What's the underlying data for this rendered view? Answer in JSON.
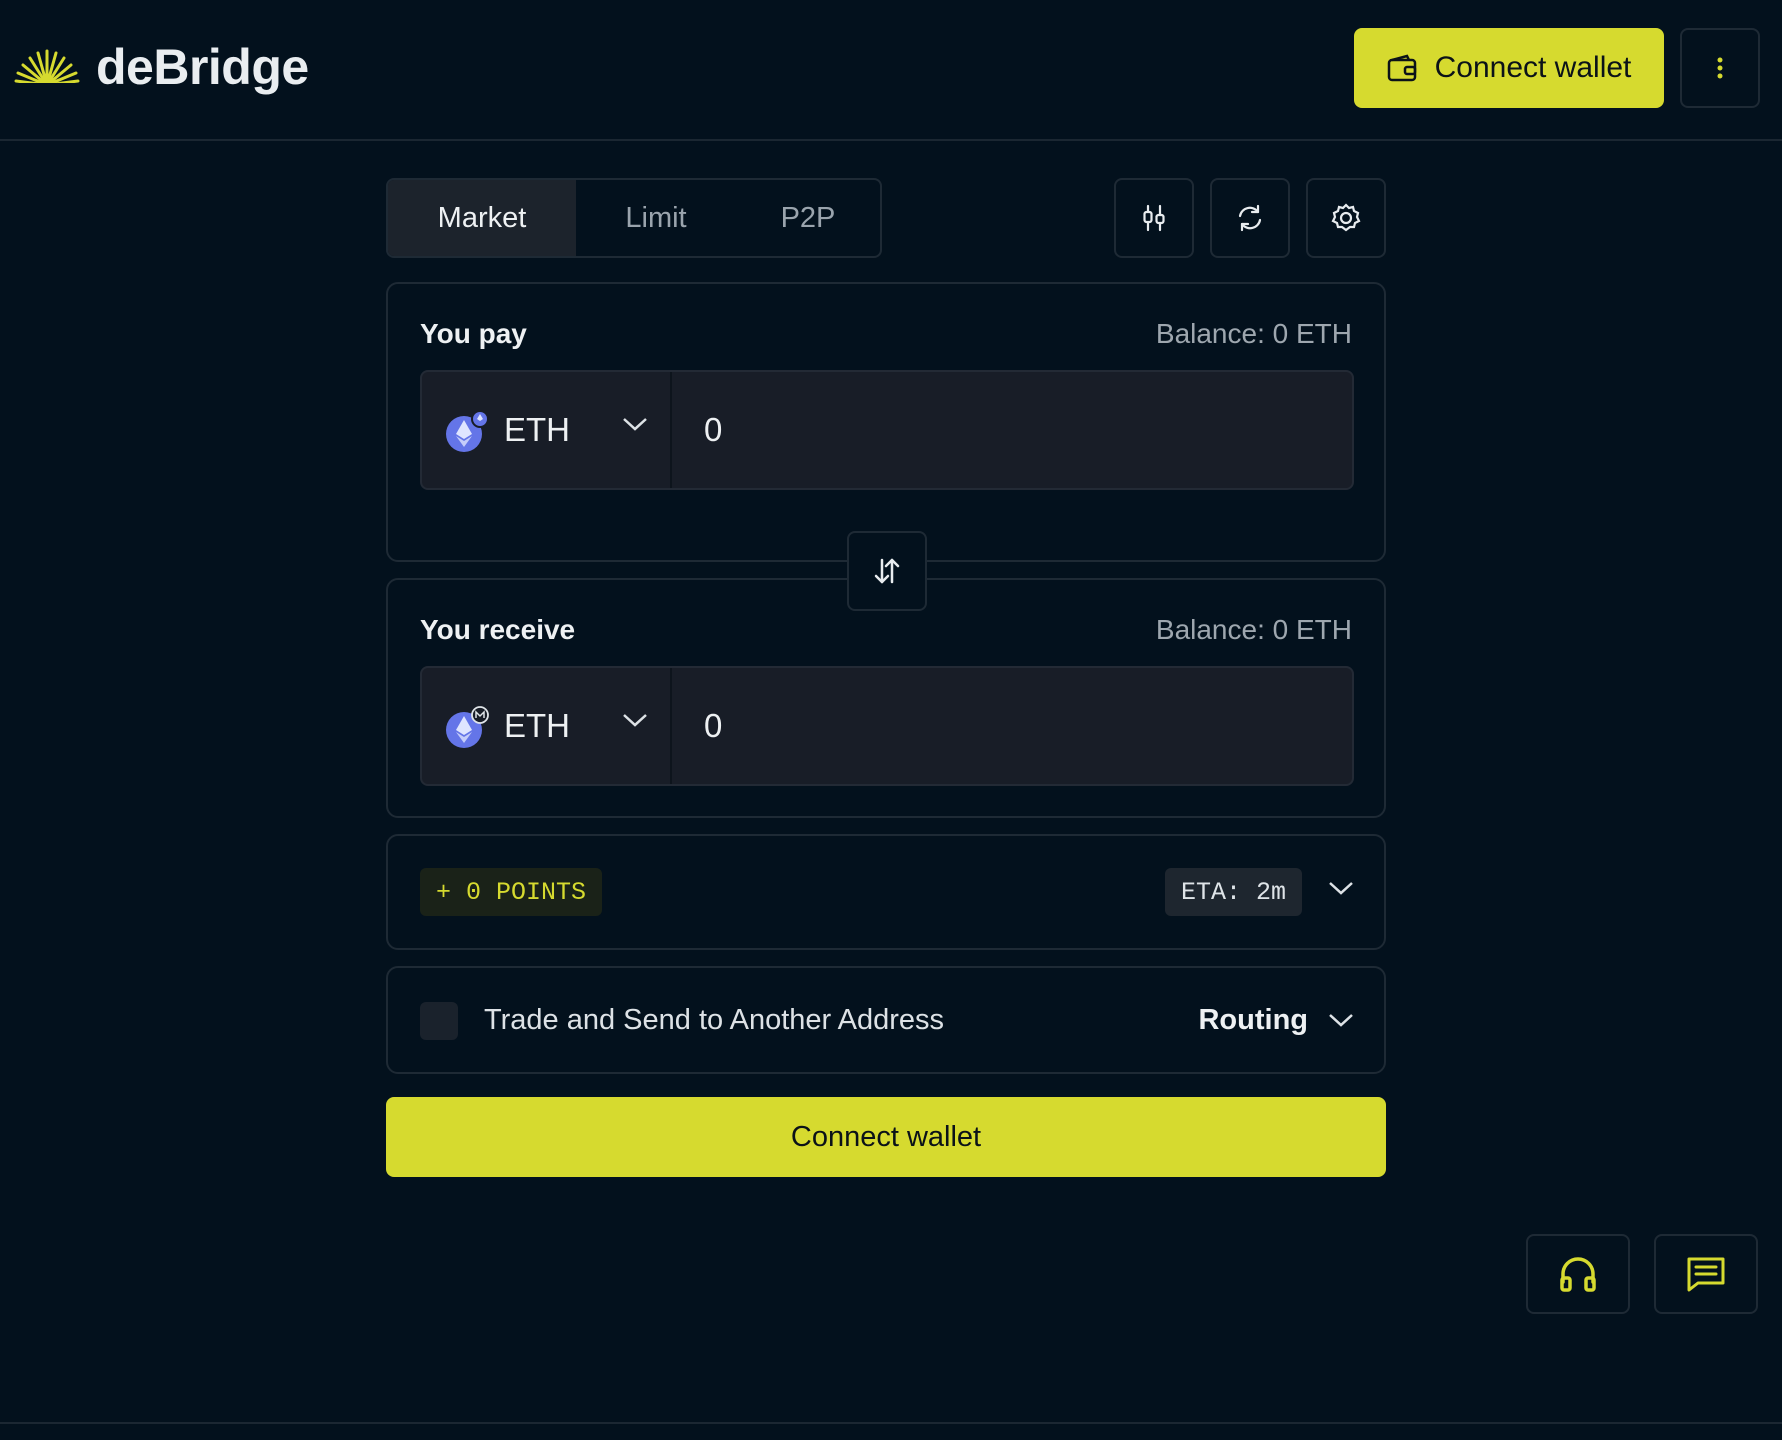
{
  "brand": {
    "name": "deBridge",
    "accent": "#d6da2f"
  },
  "header": {
    "connect_label": "Connect wallet",
    "wallet_icon": "wallet-icon",
    "more_icon": "more-vertical-icon"
  },
  "tabs": [
    {
      "label": "Market",
      "active": true
    },
    {
      "label": "Limit",
      "active": false
    },
    {
      "label": "P2P",
      "active": false
    }
  ],
  "toolbar": {
    "icons": [
      "chart-settings-icon",
      "refresh-icon",
      "settings-icon"
    ]
  },
  "pay": {
    "label": "You pay",
    "balance": "Balance: 0  ETH",
    "token": "ETH",
    "amount": "0"
  },
  "receive": {
    "label": "You receive",
    "balance": "Balance: 0 ETH",
    "token": "ETH",
    "amount": "0"
  },
  "info": {
    "points": "+ 0 POINTS",
    "eta": "ETA: 2m"
  },
  "options": {
    "send_label": "Trade and Send to Another Address",
    "routing_label": "Routing"
  },
  "main_button": {
    "label": "Connect wallet"
  },
  "floating": {
    "support_icon": "headphones-icon",
    "chat_icon": "chat-icon"
  }
}
